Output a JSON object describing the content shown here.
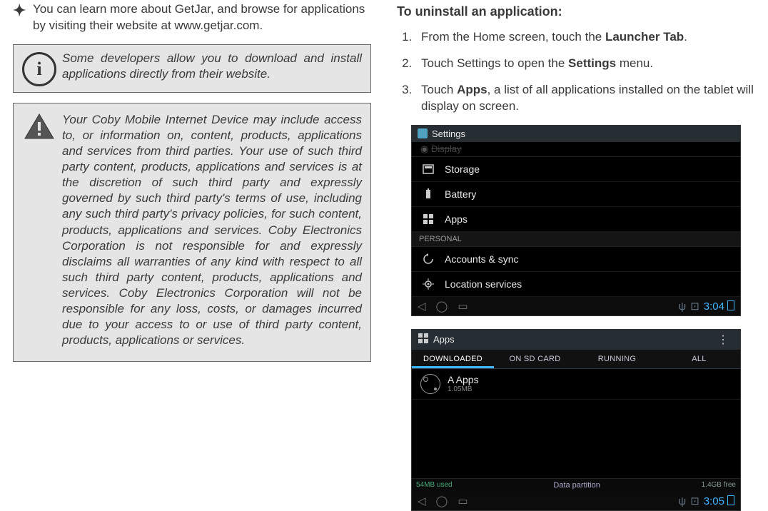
{
  "left": {
    "bullet": "You can learn more about GetJar, and browse for applications by visiting their website at www.getjar.com.",
    "info1": "Some developers allow you to download and install applications directly from their website.",
    "info2": "Your Coby Mobile Internet Device may include access to, or information on, content, products, applications and services from third parties. Your use of such third party content, products, applications and services is at the discretion of such third party and expressly governed by such third party's terms of use, including any such third party's privacy policies, for such content, products, applications and services. Coby Electronics Corporation is not responsible for and expressly disclaims all warranties of any kind with respect to all such third party content, products, applications and services. Coby Electronics Corporation will not be responsible for any loss, costs, or damages incurred due to your access to or use of third party content, products, applications or services."
  },
  "right": {
    "heading": "To uninstall an application:",
    "step1_a": "From the Home screen, touch the ",
    "step1_b": "Launcher Tab",
    "step1_c": ".",
    "step2_a": "Touch Settings to open the ",
    "step2_b": "Settings",
    "step2_c": " menu.",
    "step3_a": "Touch ",
    "step3_b": "Apps",
    "step3_c": ", a list of all applications installed on the tablet will display on screen."
  },
  "shot1": {
    "title": "Settings",
    "hidden": "Display",
    "rows": [
      "Storage",
      "Battery",
      "Apps"
    ],
    "section": "PERSONAL",
    "rows2": [
      "Accounts & sync",
      "Location services"
    ],
    "clock": "3:04"
  },
  "shot2": {
    "title": "Apps",
    "tabs": [
      "DOWNLOADED",
      "ON SD CARD",
      "RUNNING",
      "ALL"
    ],
    "app_name": "A Apps",
    "app_size": "1.05MB",
    "data_left": "54MB used",
    "data_label": "Data partition",
    "data_right": "1.4GB free",
    "clock": "3:05"
  }
}
